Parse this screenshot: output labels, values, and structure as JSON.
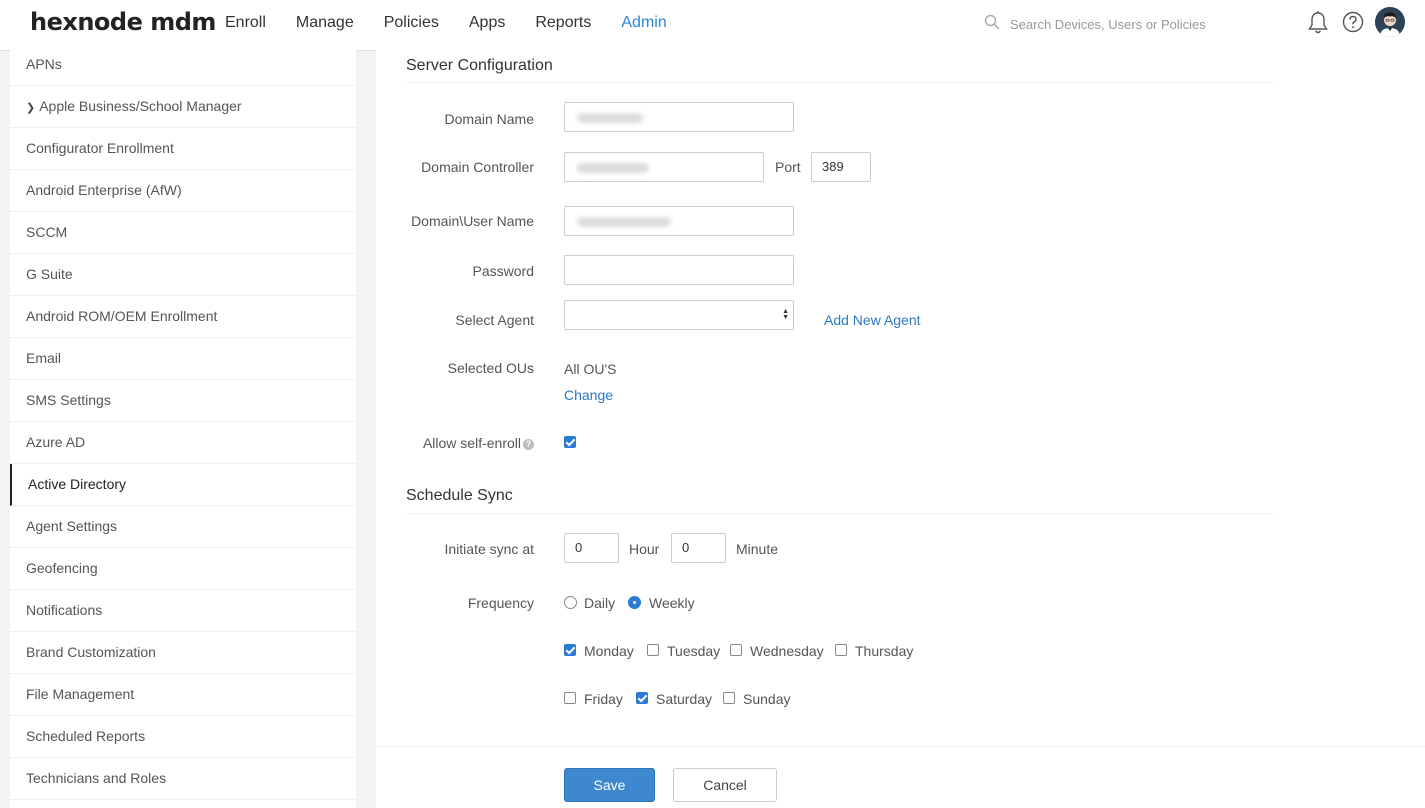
{
  "header": {
    "logo": "hexnode mdm",
    "nav": [
      "Enroll",
      "Manage",
      "Policies",
      "Apps",
      "Reports",
      "Admin"
    ],
    "active_nav": "Admin",
    "search_placeholder": "Search Devices, Users or Policies",
    "icons": [
      "bell-icon",
      "help-icon",
      "avatar"
    ]
  },
  "sidebar": {
    "items": [
      {
        "label": "APNs"
      },
      {
        "label": "Apple Business/School Manager",
        "expandable": true
      },
      {
        "label": "Configurator Enrollment"
      },
      {
        "label": "Android Enterprise (AfW)"
      },
      {
        "label": "SCCM"
      },
      {
        "label": "G Suite"
      },
      {
        "label": "Android ROM/OEM Enrollment"
      },
      {
        "label": "Email"
      },
      {
        "label": "SMS Settings"
      },
      {
        "label": "Azure AD"
      },
      {
        "label": "Active Directory",
        "active": true
      },
      {
        "label": "Agent Settings"
      },
      {
        "label": "Geofencing"
      },
      {
        "label": "Notifications"
      },
      {
        "label": "Brand Customization"
      },
      {
        "label": "File Management"
      },
      {
        "label": "Scheduled Reports"
      },
      {
        "label": "Technicians and Roles"
      }
    ]
  },
  "server": {
    "title": "Server Configuration",
    "domain_name_label": "Domain Name",
    "domain_controller_label": "Domain Controller",
    "port_label": "Port",
    "port_value": "389",
    "username_label": "Domain\\User Name",
    "password_label": "Password",
    "agent_label": "Select Agent",
    "add_agent": "Add New Agent",
    "ous_label": "Selected OUs",
    "ous_value": "All OU'S",
    "change": "Change",
    "self_enroll_label": "Allow self-enroll",
    "self_enroll_help": "?",
    "self_enroll_checked": true
  },
  "schedule": {
    "title": "Schedule Sync",
    "initiate_label": "Initiate sync at",
    "hour_value": "0",
    "hour_label": "Hour",
    "minute_value": "0",
    "minute_label": "Minute",
    "frequency_label": "Frequency",
    "daily": "Daily",
    "weekly": "Weekly",
    "selected_frequency": "Weekly",
    "days": [
      {
        "label": "Monday",
        "checked": true
      },
      {
        "label": "Tuesday",
        "checked": false
      },
      {
        "label": "Wednesday",
        "checked": false
      },
      {
        "label": "Thursday",
        "checked": false
      },
      {
        "label": "Friday",
        "checked": false
      },
      {
        "label": "Saturday",
        "checked": true
      },
      {
        "label": "Sunday",
        "checked": false
      }
    ]
  },
  "actions": {
    "save": "Save",
    "cancel": "Cancel"
  },
  "colors": {
    "accent": "#2b87d6",
    "primary_button": "#3d88cf",
    "link": "#2b78c5"
  }
}
